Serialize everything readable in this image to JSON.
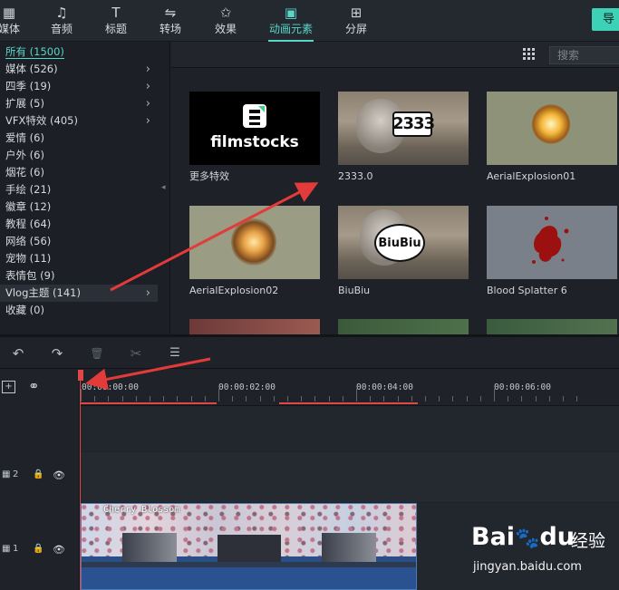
{
  "toolbar": {
    "tabs": [
      {
        "id": "media",
        "label": "媒体",
        "icon": "media-icon",
        "glyph": "▦"
      },
      {
        "id": "audio",
        "label": "音频",
        "icon": "music-note-icon",
        "glyph": "♫"
      },
      {
        "id": "title",
        "label": "标题",
        "icon": "text-title-icon",
        "glyph": "T"
      },
      {
        "id": "transition",
        "label": "转场",
        "icon": "transition-icon",
        "glyph": "⇋"
      },
      {
        "id": "effects",
        "label": "效果",
        "icon": "effects-star-icon",
        "glyph": "✩"
      },
      {
        "id": "elements",
        "label": "动画元素",
        "icon": "image-element-icon",
        "glyph": "▣",
        "active": true
      },
      {
        "id": "splitscreen",
        "label": "分屏",
        "icon": "split-screen-icon",
        "glyph": "⊞"
      }
    ],
    "export_label": "导"
  },
  "categories": [
    {
      "label": "所有 (1500)",
      "active": true,
      "chevron": false
    },
    {
      "label": "媒体 (526)",
      "chevron": true
    },
    {
      "label": "四季 (19)",
      "chevron": true
    },
    {
      "label": "扩展 (5)",
      "chevron": true
    },
    {
      "label": "VFX特效 (405)",
      "chevron": true
    },
    {
      "label": "爱情 (6)",
      "chevron": false
    },
    {
      "label": "户外 (6)",
      "chevron": false
    },
    {
      "label": "烟花 (6)",
      "chevron": false
    },
    {
      "label": "手绘 (21)",
      "chevron": false
    },
    {
      "label": "徽章 (12)",
      "chevron": false
    },
    {
      "label": "教程 (64)",
      "chevron": false
    },
    {
      "label": "网络 (56)",
      "chevron": false
    },
    {
      "label": "宠物 (11)",
      "chevron": false
    },
    {
      "label": "表情包 (9)",
      "chevron": false
    },
    {
      "label": "Vlog主题 (141)",
      "chevron": true,
      "highlight": true
    },
    {
      "label": "收藏 (0)",
      "chevron": false
    }
  ],
  "media": {
    "search_placeholder": "搜索",
    "items": [
      {
        "caption": "更多特效",
        "kind": "filmstocks",
        "logo_text": "filmstocks"
      },
      {
        "caption": "2333.0",
        "kind": "sticker",
        "sticker_text": "2333"
      },
      {
        "caption": "AerialExplosion01",
        "kind": "explosion"
      },
      {
        "caption": "AerialExplosion02",
        "kind": "explosion2"
      },
      {
        "caption": "BiuBiu",
        "kind": "bubble",
        "sticker_text": "BiuBiu"
      },
      {
        "caption": "Blood Splatter 6",
        "kind": "blood"
      }
    ]
  },
  "timeline": {
    "tools": [
      {
        "name": "undo-icon",
        "glyph": "↶"
      },
      {
        "name": "redo-icon",
        "glyph": "↷"
      },
      {
        "name": "delete-icon",
        "glyph": "🗑"
      },
      {
        "name": "cut-scissors-icon",
        "glyph": "✂"
      },
      {
        "name": "adjust-sliders-icon",
        "glyph": "☰"
      }
    ],
    "timecodes": [
      "00:00:00:00",
      "00:00:02:00",
      "00:00:04:00",
      "00:00:06:00"
    ],
    "tracks": [
      {
        "label": "2"
      },
      {
        "label": "1"
      }
    ],
    "clip_title": "Cherry Blossom"
  },
  "watermark": {
    "brand": "Bai",
    "brand2": "du",
    "suffix": "经验",
    "url": "jingyan.baidu.com"
  },
  "colors": {
    "accent": "#5ad6c8",
    "export_button": "#3dd1b7",
    "playhead": "#e04848",
    "annotation_arrow": "#e33a3a"
  }
}
